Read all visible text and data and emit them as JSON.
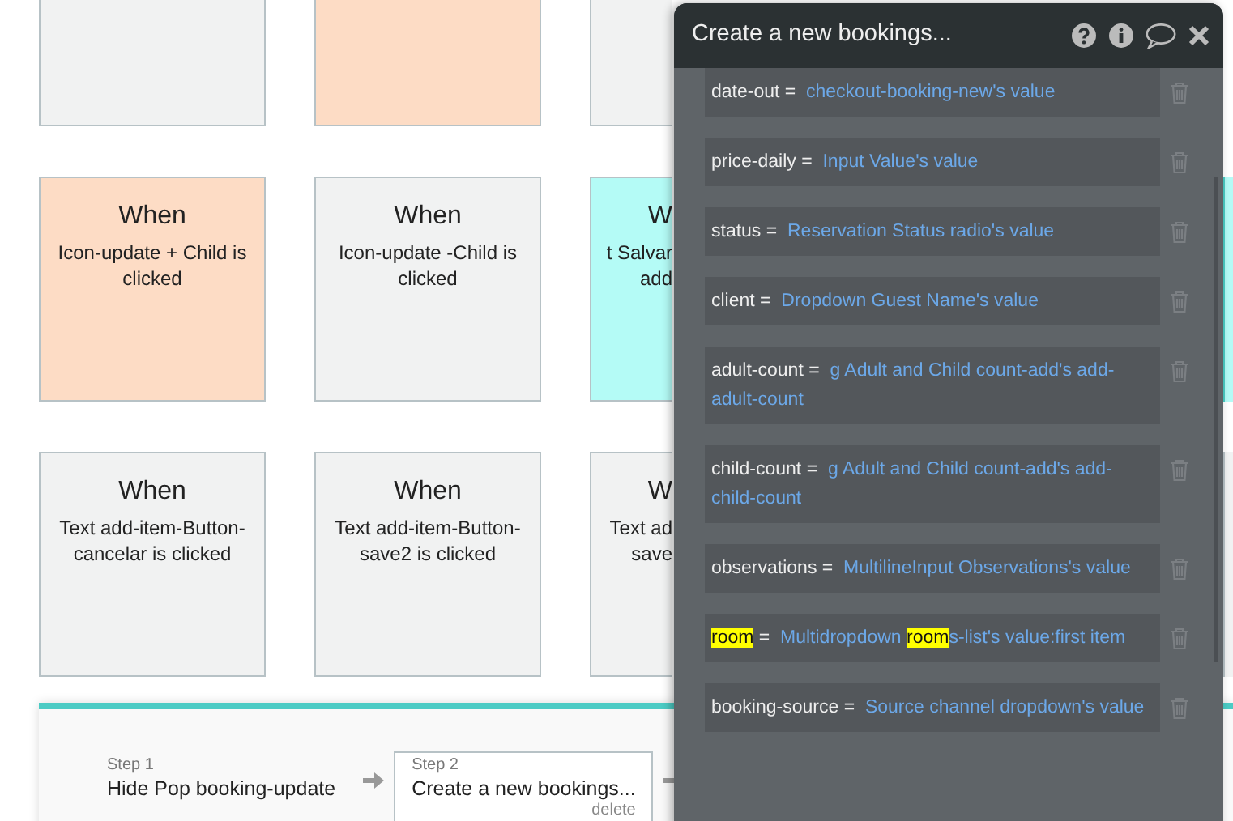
{
  "event_cards": [
    {
      "color": "#f1f2f2"
    },
    {
      "color": "#fddcc5"
    },
    {
      "color": "#f1f2f2"
    },
    {
      "color": "#fddcc5",
      "heading": "When",
      "text": "Icon-update + Child is clicked"
    },
    {
      "color": "#f1f2f2",
      "heading": "When",
      "text": "Icon-update -Child is clicked"
    },
    {
      "color": "#b4fbf6",
      "heading": "W",
      "text": "t Salvar\nadd"
    },
    {
      "color": "#f1f2f2",
      "heading": "When",
      "text": "Text add-item-Button-cancelar is clicked"
    },
    {
      "color": "#f1f2f2",
      "heading": "When",
      "text": "Text add-item-Button-save2 is clicked"
    },
    {
      "color": "#f1f2f2",
      "heading": "W",
      "text": "Text ad\nsave"
    }
  ],
  "workflow": {
    "steps": [
      {
        "label": "Step 1",
        "title": "Hide Pop booking-update",
        "selected": false
      },
      {
        "label": "Step 2",
        "title": "Create a new bookings...",
        "selected": true,
        "action": "delete"
      }
    ]
  },
  "panel": {
    "title": "Create a new bookings...",
    "fields": [
      {
        "key": "date-out",
        "key_highlighted": false,
        "operator": "=",
        "value": [
          {
            "text": "checkout-booking-new's value",
            "highlighted": false
          }
        ]
      },
      {
        "key": "price-daily",
        "key_highlighted": false,
        "operator": "=",
        "value": [
          {
            "text": "Input Value's value",
            "highlighted": false
          }
        ]
      },
      {
        "key": "status",
        "key_highlighted": false,
        "operator": "=",
        "value": [
          {
            "text": "Reservation Status radio's value",
            "highlighted": false
          }
        ]
      },
      {
        "key": "client",
        "key_highlighted": false,
        "operator": "=",
        "value": [
          {
            "text": "Dropdown Guest Name's value",
            "highlighted": false
          }
        ]
      },
      {
        "key": "adult-count",
        "key_highlighted": false,
        "operator": "=",
        "value": [
          {
            "text": "g Adult and Child count-add's add-adult-count",
            "highlighted": false
          }
        ]
      },
      {
        "key": "child-count",
        "key_highlighted": false,
        "operator": "=",
        "value": [
          {
            "text": "g Adult and Child count-add's add-child-count",
            "highlighted": false
          }
        ]
      },
      {
        "key": "observations",
        "key_highlighted": false,
        "operator": "=",
        "value": [
          {
            "text": "MultilineInput Observations's value",
            "highlighted": false
          }
        ]
      },
      {
        "key": "room",
        "key_highlighted": true,
        "operator": "=",
        "value": [
          {
            "text": "Multidropdown ",
            "highlighted": false
          },
          {
            "text": "room",
            "highlighted": true
          },
          {
            "text": "s-list's value:first item",
            "highlighted": false
          }
        ]
      },
      {
        "key": "booking-source",
        "key_highlighted": false,
        "operator": "=",
        "value": [
          {
            "text": "Source channel dropdown's value",
            "highlighted": false
          }
        ]
      }
    ]
  }
}
